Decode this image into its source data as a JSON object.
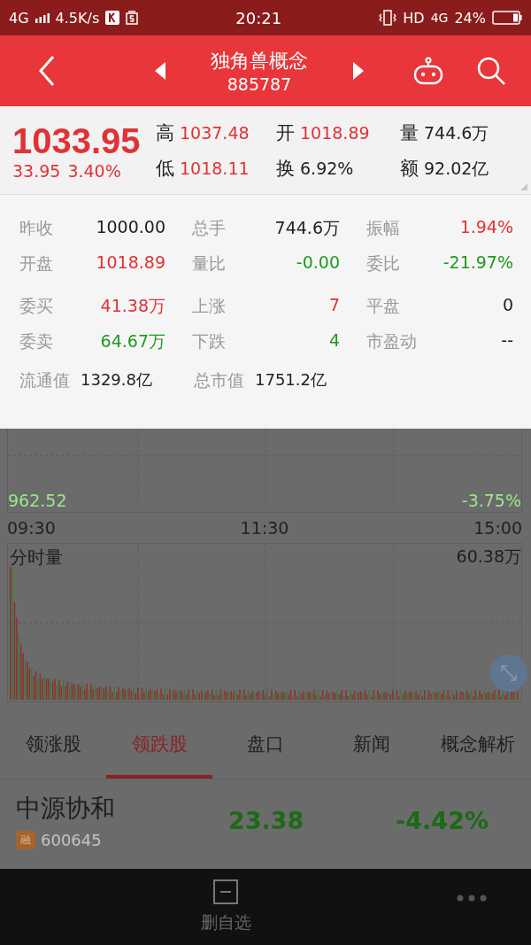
{
  "status_bar": {
    "network": "4G",
    "speed": "4.5K/s",
    "time": "20:21",
    "hd": "HD",
    "network_right": "4G",
    "battery": "24%"
  },
  "header": {
    "title": "独角兽概念",
    "code": "885787"
  },
  "quote": {
    "price": "1033.95",
    "change": "33.95",
    "change_pct": "3.40%",
    "color": "#e03236",
    "stats": [
      {
        "label": "高",
        "value": "1037.48",
        "color": "#e03236"
      },
      {
        "label": "开",
        "value": "1018.89",
        "color": "#e03236"
      },
      {
        "label": "量",
        "value": "744.6万",
        "color": "#222222"
      },
      {
        "label": "低",
        "value": "1018.11",
        "color": "#e03236"
      },
      {
        "label": "换",
        "value": "6.92%",
        "color": "#222222"
      },
      {
        "label": "额",
        "value": "92.02亿",
        "color": "#222222"
      }
    ]
  },
  "details": [
    [
      {
        "label": "昨收",
        "value": "1000.00",
        "color": "#222222"
      },
      {
        "label": "总手",
        "value": "744.6万",
        "color": "#222222"
      },
      {
        "label": "振幅",
        "value": "1.94%",
        "color": "#e03236"
      }
    ],
    [
      {
        "label": "开盘",
        "value": "1018.89",
        "color": "#e03236"
      },
      {
        "label": "量比",
        "value": "-0.00",
        "color": "#1e9a1e"
      },
      {
        "label": "委比",
        "value": "-21.97%",
        "color": "#1e9a1e"
      }
    ],
    [
      {
        "label": "委买",
        "value": "41.38万",
        "color": "#e03236"
      },
      {
        "label": "上涨",
        "value": "7",
        "color": "#e03236"
      },
      {
        "label": "平盘",
        "value": "0",
        "color": "#222222"
      }
    ],
    [
      {
        "label": "委卖",
        "value": "64.67万",
        "color": "#1e9a1e"
      },
      {
        "label": "下跌",
        "value": "4",
        "color": "#1e9a1e"
      },
      {
        "label": "市盈动",
        "value": "--",
        "color": "#222222"
      }
    ]
  ],
  "market_values": [
    {
      "label": "流通值",
      "value": "1329.8亿"
    },
    {
      "label": "总市值",
      "value": "1751.2亿"
    }
  ],
  "chart": {
    "low_price": "962.52",
    "low_pct": "-3.75%",
    "times": [
      "09:30",
      "11:30",
      "15:00"
    ],
    "volume_label": "分时量",
    "volume_max": "60.38万"
  },
  "tabs": [
    {
      "label": "领涨股",
      "selected": false
    },
    {
      "label": "领跌股",
      "selected": true
    },
    {
      "label": "盘口",
      "selected": false
    },
    {
      "label": "新闻",
      "selected": false
    },
    {
      "label": "概念解析",
      "selected": false
    }
  ],
  "stocks": [
    {
      "name": "中源协和",
      "badge": "融",
      "code": "600645",
      "price": "23.38",
      "change_pct": "-4.42%",
      "color": "#1c6a16"
    }
  ],
  "bottom_bar": {
    "items": [
      {
        "label": "删自选"
      }
    ]
  }
}
